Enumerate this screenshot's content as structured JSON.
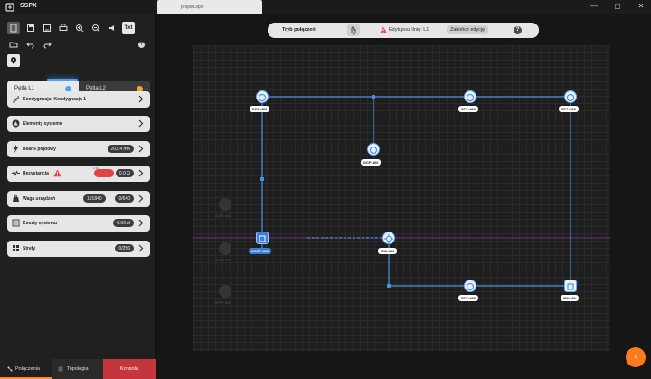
{
  "window": {
    "app_name": "SSPX",
    "document_tab": "projekt.spx*",
    "controls": [
      "minimize",
      "maximize",
      "close"
    ]
  },
  "toolbar": {
    "buttons": [
      {
        "name": "new-file-icon"
      },
      {
        "name": "save-icon"
      },
      {
        "name": "save-as-icon"
      },
      {
        "name": "print-icon"
      },
      {
        "name": "zoom-in-icon"
      },
      {
        "name": "zoom-out-icon"
      },
      {
        "name": "sound-icon"
      },
      {
        "name": "text-toggle",
        "label": "Txt"
      },
      {
        "name": "folder-icon"
      },
      {
        "name": "undo-icon"
      },
      {
        "name": "redo-icon"
      },
      {
        "name": "map-pin-icon"
      }
    ],
    "help": "?"
  },
  "loops": [
    {
      "label": "Pętla L1",
      "dot_color": "#4aa3ff",
      "active": true
    },
    {
      "label": "Pętla L2",
      "dot_color": "#f5a623",
      "active": false
    }
  ],
  "sidebar": {
    "items": [
      {
        "label": "Kondygnacja: Kondygnacja 1",
        "icon": "stairs-icon"
      },
      {
        "label": "Elementy systemu",
        "icon": "triangle-icon"
      },
      {
        "label": "Bilans prądowy",
        "icon": "bolt-icon",
        "value": "203.4 mA"
      },
      {
        "label": "Rezystancja",
        "icon": "resistor-icon",
        "warn": true,
        "value": "0.0 Ω",
        "red_value": "1.54"
      },
      {
        "label": "Waga urządzeń",
        "icon": "weight-icon",
        "value": "191840",
        "value2": "0/640"
      },
      {
        "label": "Koszty systemu",
        "icon": "list-icon",
        "value": "0.00 zł"
      },
      {
        "label": "Strefy",
        "icon": "zones-icon",
        "value": "0/256"
      }
    ]
  },
  "bottom_tabs": {
    "connections": "Połączenia",
    "topology": "Topologia",
    "console": "Konsola"
  },
  "modebar": {
    "mode_label": "Tryb połączeń",
    "editing_text": "Edytujesz linię: L1",
    "end_button": "Zakończ edycję",
    "help": "?"
  },
  "nodes": [
    {
      "id": "DRP-400"
    },
    {
      "id": "SPP-400a",
      "label": "SPP-400"
    },
    {
      "id": "SPP-400b",
      "label": "SPP-400"
    },
    {
      "id": "DCP-400"
    },
    {
      "id": "ACSP-400"
    },
    {
      "id": "MUI-400"
    },
    {
      "id": "SPP-400c",
      "label": "SPP-400"
    },
    {
      "id": "MZ-400"
    }
  ],
  "ghost_nodes": [
    "ACSP-400",
    "ACSP-STO",
    "SPPR-400"
  ],
  "accent": "#4a8fdf",
  "fab_icon": "chevron-left-icon"
}
